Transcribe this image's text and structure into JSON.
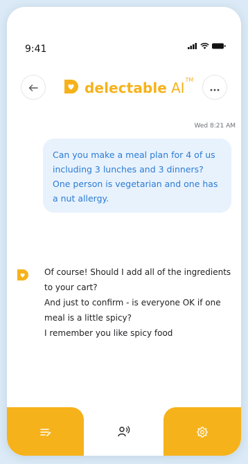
{
  "status_bar": {
    "time": "9:41"
  },
  "header": {
    "back_icon": "arrow-left-icon",
    "logo_name": "delectable",
    "logo_suffix": "AI",
    "logo_tm": "TM",
    "more_icon": "ellipsis-icon"
  },
  "chat": {
    "timestamp": "Wed 8:21 AM",
    "user_message": {
      "lines": [
        "Can you make a meal plan for 4 of us  including 3 lunches and 3 dinners?",
        "One person is vegetarian and one has a nut  allergy."
      ]
    },
    "ai_message": {
      "lines": [
        "Of course! Should I add all of the ingredients to your cart?",
        "And just to confirm - is everyone OK if one meal is a little spicy?",
        "I remember you like spicy food"
      ]
    }
  },
  "bottom_nav": {
    "items": [
      {
        "icon": "list-edit-icon"
      },
      {
        "icon": "voice-assistant-icon"
      },
      {
        "icon": "settings-gear-icon"
      }
    ]
  },
  "colors": {
    "brand": "#f6b21b",
    "user_bubble_bg": "#e8f2fd",
    "user_text": "#2b7bd3",
    "background": "#dbeaf6"
  }
}
